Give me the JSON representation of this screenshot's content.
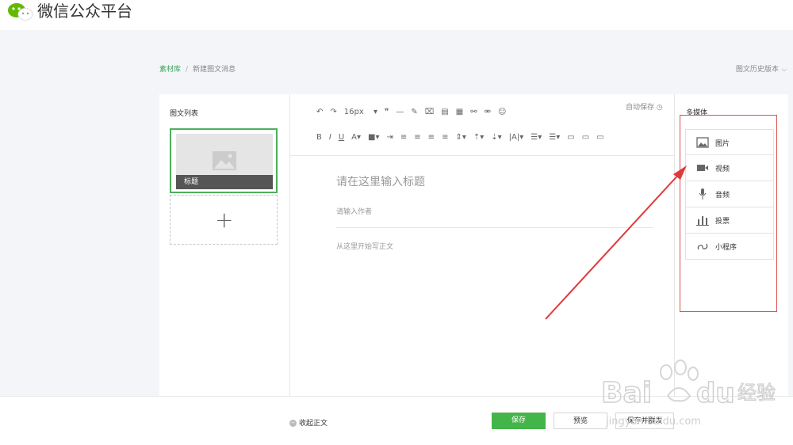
{
  "header": {
    "brand": "微信公众平台",
    "logo_icon": "wechat-logo-icon"
  },
  "breadcrumb": {
    "library": "素材库",
    "separator": "/",
    "current": "新建图文消息"
  },
  "history_label": "图文历史版本",
  "article_list": {
    "title": "图文列表",
    "card_label": "标题",
    "add_symbol": "+"
  },
  "editor": {
    "autosave_label": "自动保存",
    "font_size": "16px",
    "title_placeholder": "请在这里输入标题",
    "author_placeholder": "请输入作者",
    "body_placeholder": "从这里开始写正文"
  },
  "media": {
    "title": "多媒体",
    "items": [
      {
        "label": "图片",
        "icon": "image-icon"
      },
      {
        "label": "视频",
        "icon": "video-icon"
      },
      {
        "label": "音频",
        "icon": "audio-icon"
      },
      {
        "label": "投票",
        "icon": "vote-icon"
      },
      {
        "label": "小程序",
        "icon": "miniprogram-icon"
      }
    ]
  },
  "footer": {
    "collapse_label": "收起正文",
    "save_label": "保存",
    "preview_label": "预览",
    "mass_send_label": "保存并群发"
  },
  "watermark": {
    "brand": "Baidu经验",
    "url": "jingyan.baidu.com"
  },
  "colors": {
    "accent": "#44b549",
    "annotation": "#e0393b"
  }
}
